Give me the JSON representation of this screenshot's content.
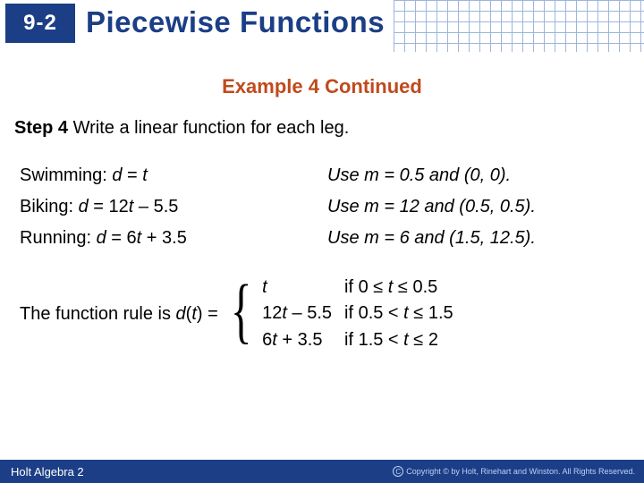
{
  "header": {
    "lesson_number": "9-2",
    "title": "Piecewise Functions"
  },
  "example_heading": "Example 4 Continued",
  "step": {
    "label": "Step 4",
    "text": "Write a linear function for each leg."
  },
  "legs": [
    {
      "name": "Swimming:",
      "eq_pre": "d",
      "eq_mid": " = ",
      "eq_var": "t",
      "eq_post": "",
      "hint": "Use m = 0.5 and (0, 0)."
    },
    {
      "name": "Biking:",
      "eq_pre": "d",
      "eq_mid": " = 12",
      "eq_var": "t",
      "eq_post": " – 5.5",
      "hint": "Use m = 12 and (0.5, 0.5)."
    },
    {
      "name": "Running:",
      "eq_pre": "d",
      "eq_mid": " = 6",
      "eq_var": "t",
      "eq_post": " + 3.5",
      "hint": "Use m = 6 and (1.5, 12.5)."
    }
  ],
  "rule_intro": "The function rule is ",
  "rule_fn_pre": "d",
  "rule_fn_open": "(",
  "rule_fn_arg": "t",
  "rule_fn_close": ") = ",
  "pieces": [
    {
      "expr_var": "t",
      "expr_pre": "",
      "expr_post": "",
      "cond_pre": "if 0 ≤ ",
      "cond_var": "t",
      "cond_post": " ≤ 0.5"
    },
    {
      "expr_var": "t",
      "expr_pre": "12",
      "expr_post": " – 5.5",
      "cond_pre": "if 0.5 < ",
      "cond_var": "t",
      "cond_post": " ≤ 1.5"
    },
    {
      "expr_var": "t",
      "expr_pre": "6",
      "expr_post": " + 3.5",
      "cond_pre": "if 1.5 < ",
      "cond_var": "t",
      "cond_post": " ≤ 2"
    }
  ],
  "footer": {
    "book": "Holt Algebra 2",
    "copyright": "Copyright © by Holt, Rinehart and Winston. All Rights Reserved."
  }
}
